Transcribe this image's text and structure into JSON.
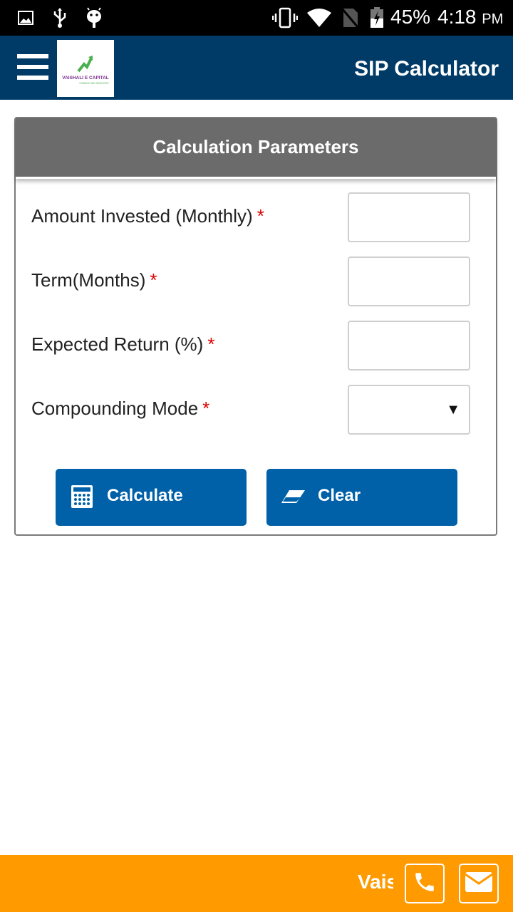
{
  "status_bar": {
    "icons": [
      "image-icon",
      "usb-icon",
      "android-debug-icon",
      "vibrate-icon",
      "wifi-icon",
      "no-sim-icon",
      "battery-charging-icon"
    ],
    "battery": "45%",
    "time": "4:18",
    "time_suffix": "PM"
  },
  "app_bar": {
    "menu_icon": "hamburger-icon",
    "logo_text": "VAISHALI E CAPITAL",
    "logo_tagline": "CONSULTING SERVICES",
    "title": "SIP Calculator"
  },
  "panel": {
    "title": "Calculation Parameters",
    "fields": [
      {
        "label": "Amount Invested (Monthly)",
        "required": "*",
        "value": "",
        "type": "input"
      },
      {
        "label": "Term(Months)",
        "required": "*",
        "value": "",
        "type": "input"
      },
      {
        "label": "Expected Return (%)",
        "required": "*",
        "value": "",
        "type": "input"
      },
      {
        "label": "Compounding Mode",
        "required": "*",
        "value": "",
        "type": "select"
      }
    ],
    "buttons": {
      "calculate": {
        "label": "Calculate",
        "icon": "calculator-icon"
      },
      "clear": {
        "label": "Clear",
        "icon": "eraser-icon"
      }
    }
  },
  "footer": {
    "marquee_text": "Vaishali E Capital",
    "phone_icon": "phone-icon",
    "email_icon": "email-icon"
  },
  "colors": {
    "app_bar": "#003a66",
    "panel_header": "#6b6b6b",
    "button": "#0061a8",
    "footer": "#ff9a00",
    "required": "#dd0000"
  }
}
